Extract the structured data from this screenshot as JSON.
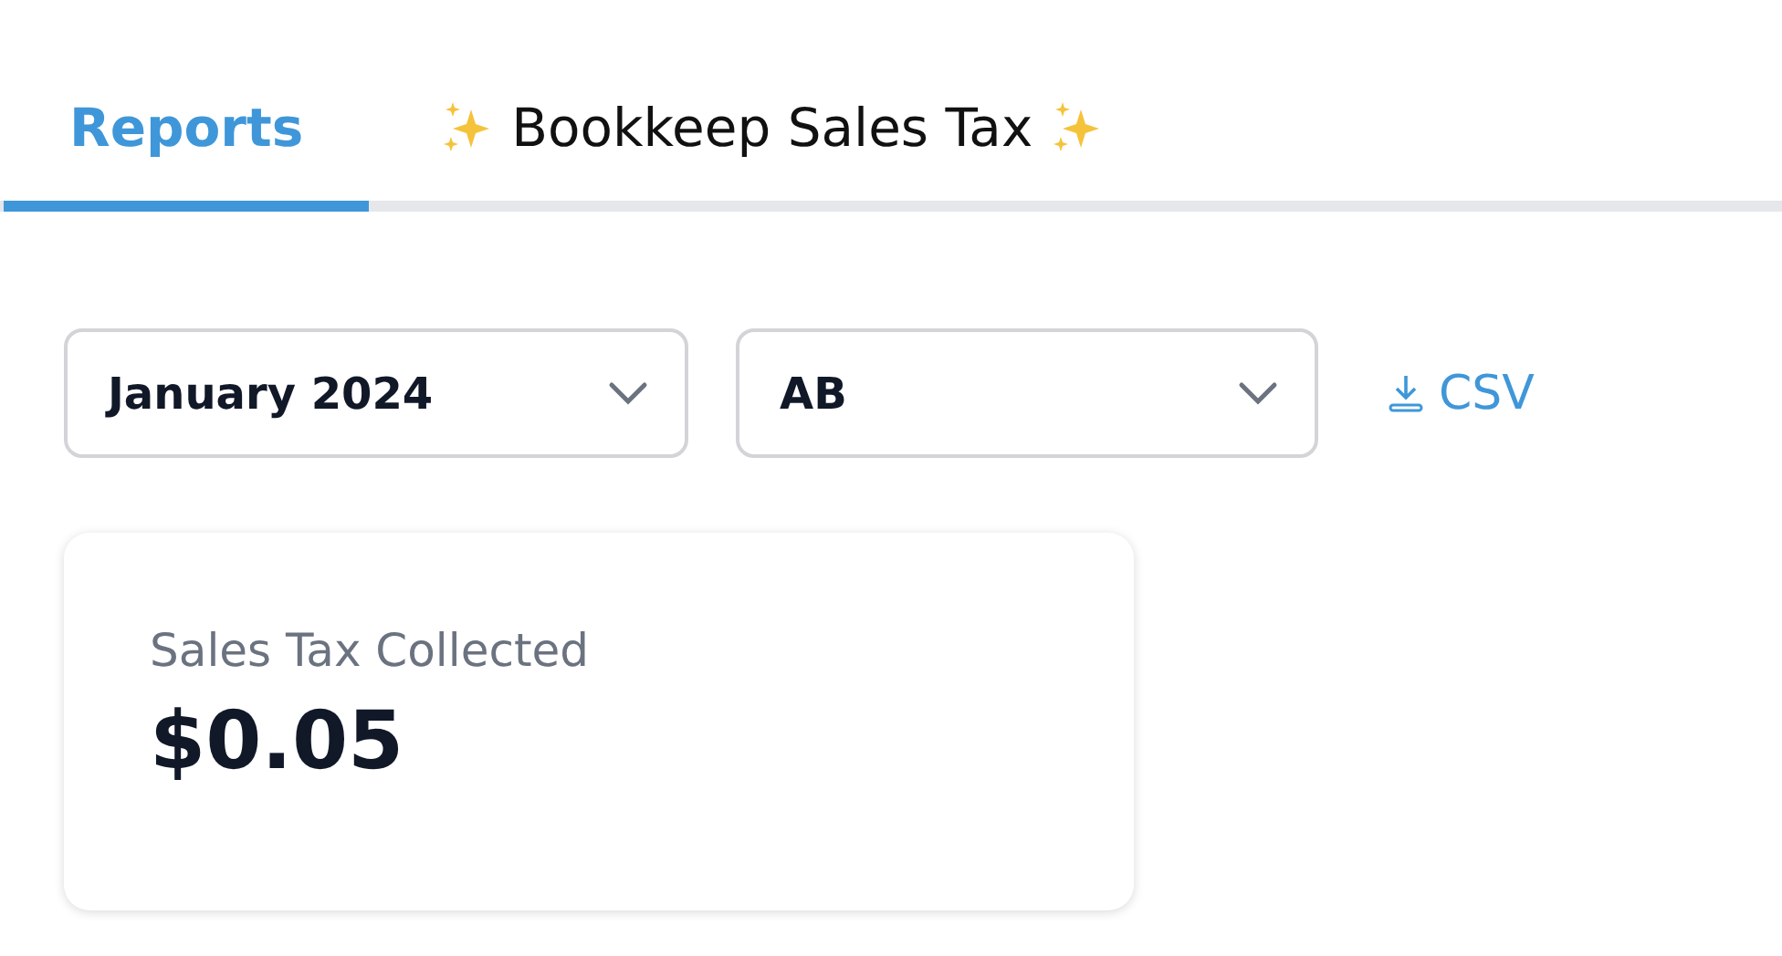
{
  "tabs": [
    {
      "label": "Reports",
      "selected": true,
      "sparkles": false
    },
    {
      "label": "Bookkeep Sales Tax",
      "selected": false,
      "sparkles": true
    }
  ],
  "filters": [
    {
      "value": "January 2024"
    },
    {
      "value": "AB"
    }
  ],
  "export_link": {
    "label": "CSV"
  },
  "card": {
    "title": "Sales Tax Collected",
    "value": "$0.05"
  }
}
